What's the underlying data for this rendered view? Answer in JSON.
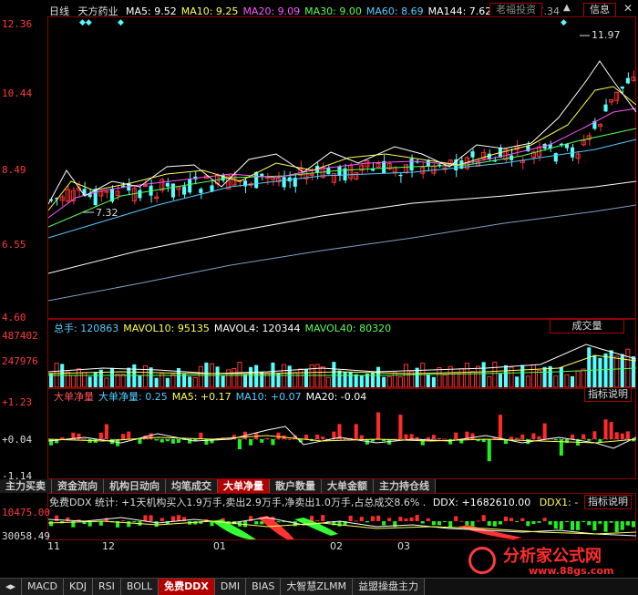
{
  "header": {
    "period": "日线",
    "stock_name": "天方药业",
    "ma": [
      {
        "label": "MA5: 9.52",
        "color": "#ffffff"
      },
      {
        "label": "MA10: 9.25",
        "color": "#ffff55"
      },
      {
        "label": "MA20: 9.09",
        "color": "#ff55ff"
      },
      {
        "label": "MA30: 9.00",
        "color": "#55ff55"
      },
      {
        "label": "MA60: 8.69",
        "color": "#55ccff"
      },
      {
        "label": "MA144: 7.62",
        "color": "#ffffff"
      },
      {
        "label": "MA250: 7.34",
        "color": "#aaaaaa"
      }
    ],
    "note_button": "老福投资",
    "info_button": "信息"
  },
  "price_axis": [
    "12.36",
    "10.44",
    "8.49",
    "6.55",
    "4.60"
  ],
  "price_annotations": {
    "high": "11.97",
    "low": "7.32"
  },
  "volume": {
    "legend": [
      {
        "label": "总手: 120863",
        "color": "#55ccff"
      },
      {
        "label": "MAVOL10: 95135",
        "color": "#ffff55"
      },
      {
        "label": "MAVOL4: 120344",
        "color": "#ffffff"
      },
      {
        "label": "MAVOL40: 80320",
        "color": "#55ff55"
      }
    ],
    "axis": [
      "487402",
      "247976"
    ],
    "title_button": "成交量"
  },
  "net_flow": {
    "legend": [
      {
        "label": "大单净量",
        "color": "#ff5555"
      },
      {
        "label": "大单净量: 0.25",
        "color": "#55ccff"
      },
      {
        "label": "MA5: +0.17",
        "color": "#ffff55"
      },
      {
        "label": "MA10: +0.07",
        "color": "#55ccff"
      },
      {
        "label": "MA20: -0.04",
        "color": "#ffffff"
      }
    ],
    "axis": [
      "+1.23",
      "+0.04",
      "-1.14"
    ],
    "help_button": "指标说明"
  },
  "tabs": [
    "主力买卖",
    "资金流向",
    "机构日动向",
    "均笔成交",
    "大单净量",
    "散户数量",
    "大单金额",
    "主力持仓线"
  ],
  "active_tab": "大单净量",
  "ddx": {
    "stats": "免费DDX 统计: +1天机构买入1.9万手,卖出2.9万手,净卖出1.0万手,占总成交8.6% .",
    "ddx": "DDX: +1682610.00",
    "ddx1": "DDX1: -",
    "axis": [
      "10475.00",
      "30058.49"
    ],
    "help_button": "指标说明"
  },
  "time_axis": [
    "11",
    "12",
    "01",
    "02",
    "03"
  ],
  "watermark": {
    "cn": "分析家公式网",
    "url": "www.88gs.com"
  },
  "bottom_tabs": [
    "MACD",
    "KDJ",
    "RSI",
    "BOLL",
    "免费DDX",
    "DMI",
    "BIAS",
    "大智慧ZLMM",
    "益盟操盘主力"
  ],
  "active_bottom_tab": "免费DDX",
  "colors": {
    "up": "#ff3333",
    "down": "#55ffff",
    "frame": "#8a0000"
  }
}
